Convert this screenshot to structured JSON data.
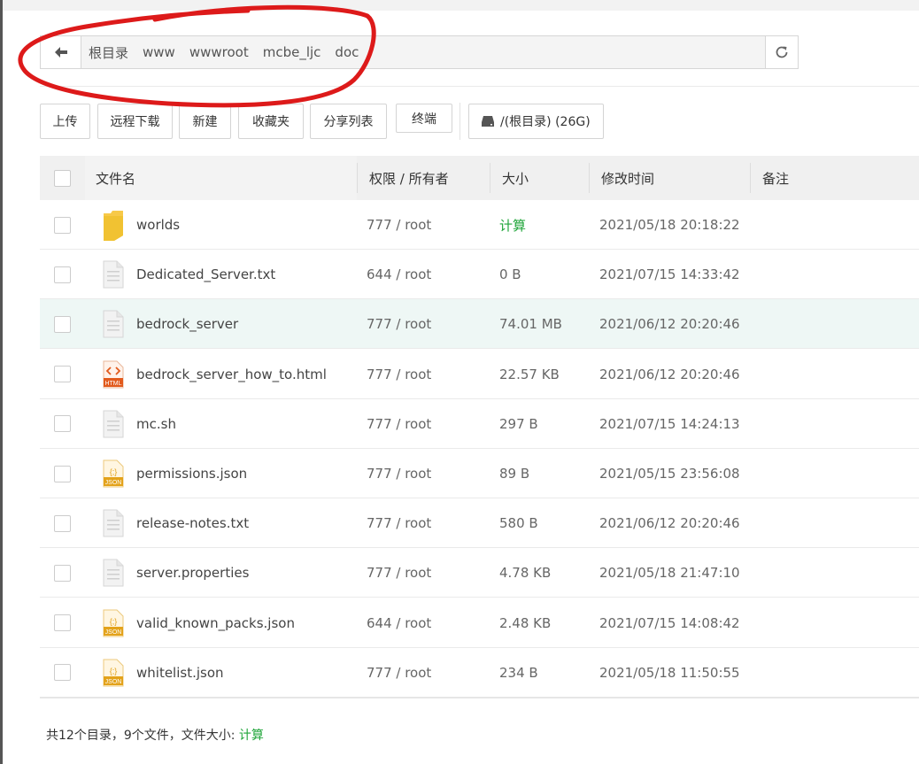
{
  "path": {
    "crumbs": [
      "根目录",
      "www",
      "wwwroot",
      "mcbe_ljc",
      "doc"
    ]
  },
  "toolbar": {
    "upload": "上传",
    "remote_download": "远程下载",
    "new": "新建",
    "favorites": "收藏夹",
    "share_list": "分享列表",
    "terminal": "终端",
    "disk": "/(根目录) (26G)"
  },
  "table": {
    "headers": {
      "name": "文件名",
      "perm": "权限 / 所有者",
      "size": "大小",
      "mtime": "修改时间",
      "note": "备注"
    },
    "rows": [
      {
        "name": "worlds",
        "perm": "777 / root",
        "size": "计算",
        "mtime": "2021/05/18 20:18:22",
        "icon": "folder-icon"
      },
      {
        "name": "Dedicated_Server.txt",
        "perm": "644 / root",
        "size": "0 B",
        "mtime": "2021/07/15 14:33:42",
        "icon": "text-file-icon"
      },
      {
        "name": "bedrock_server",
        "perm": "777 / root",
        "size": "74.01 MB",
        "mtime": "2021/06/12 20:20:46",
        "icon": "file-icon"
      },
      {
        "name": "bedrock_server_how_to.html",
        "perm": "777 / root",
        "size": "22.57 KB",
        "mtime": "2021/06/12 20:20:46",
        "icon": "html-file-icon"
      },
      {
        "name": "mc.sh",
        "perm": "777 / root",
        "size": "297 B",
        "mtime": "2021/07/15 14:24:13",
        "icon": "file-icon"
      },
      {
        "name": "permissions.json",
        "perm": "777 / root",
        "size": "89 B",
        "mtime": "2021/05/15 23:56:08",
        "icon": "json-file-icon"
      },
      {
        "name": "release-notes.txt",
        "perm": "777 / root",
        "size": "580 B",
        "mtime": "2021/06/12 20:20:46",
        "icon": "text-file-icon"
      },
      {
        "name": "server.properties",
        "perm": "777 / root",
        "size": "4.78 KB",
        "mtime": "2021/05/18 21:47:10",
        "icon": "file-icon"
      },
      {
        "name": "valid_known_packs.json",
        "perm": "644 / root",
        "size": "2.48 KB",
        "mtime": "2021/07/15 14:08:42",
        "icon": "json-file-icon"
      },
      {
        "name": "whitelist.json",
        "perm": "777 / root",
        "size": "234 B",
        "mtime": "2021/05/18 11:50:55",
        "icon": "json-file-icon"
      }
    ]
  },
  "summary": {
    "text": "共12个目录，9个文件，文件大小: ",
    "calc": "计算"
  },
  "colors": {
    "accent_green": "#20a53a",
    "highlight_row": "#eef7f5",
    "annotation_red": "#dd1a1a"
  }
}
